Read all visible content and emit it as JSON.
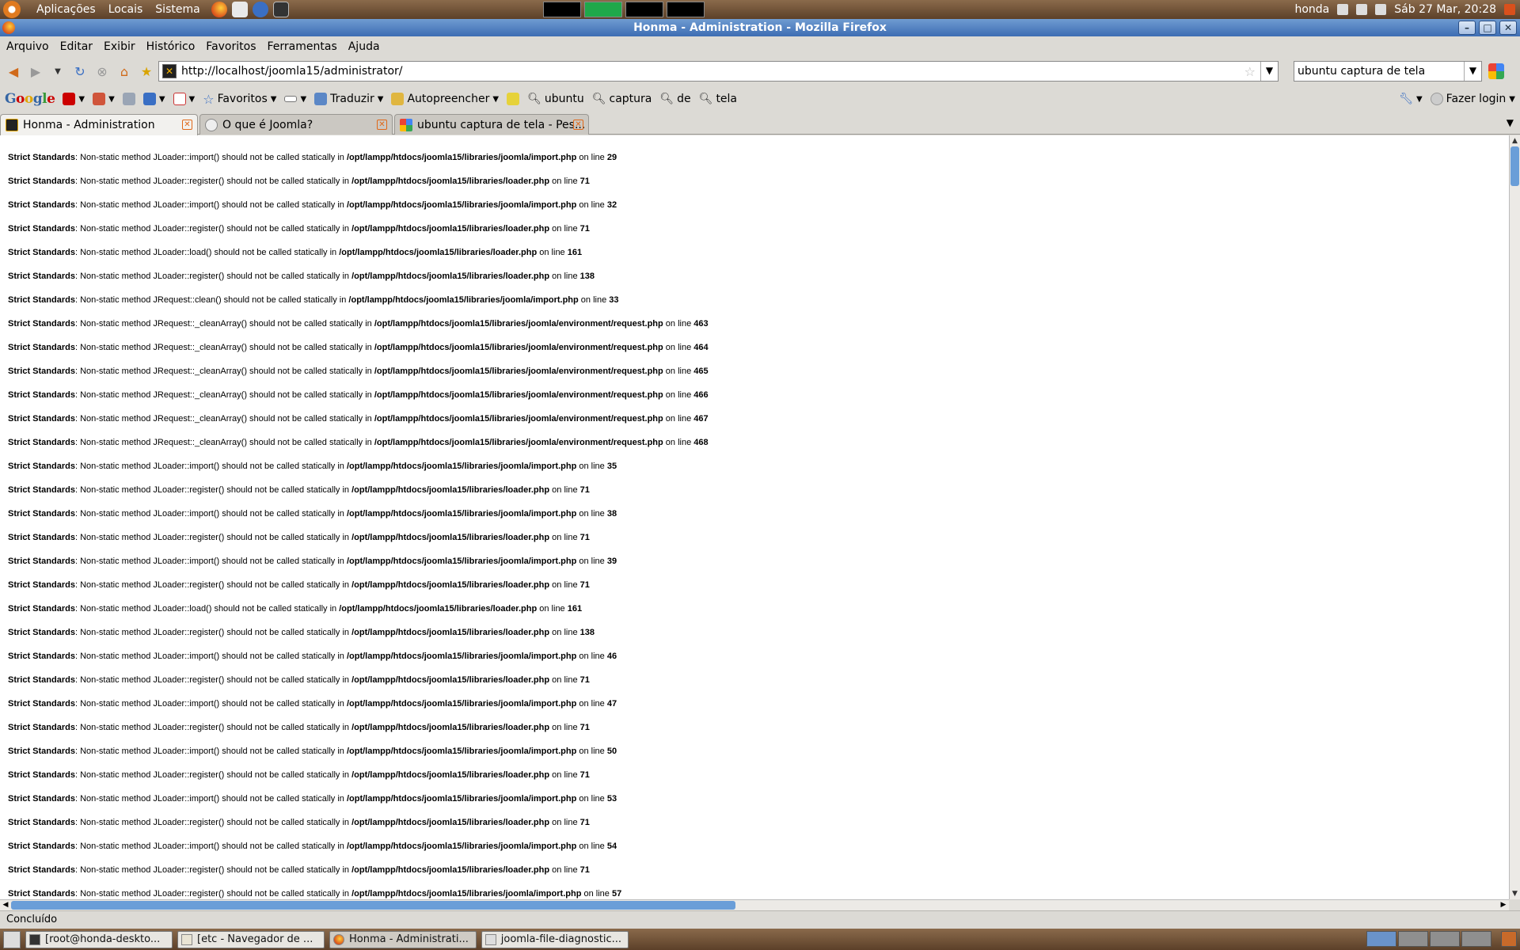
{
  "top_panel": {
    "menus": [
      "Aplicações",
      "Locais",
      "Sistema"
    ],
    "user": "honda",
    "clock": "Sáb 27 Mar, 20:28"
  },
  "window": {
    "title": "Honma - Administration - Mozilla Firefox"
  },
  "menubar": [
    "Arquivo",
    "Editar",
    "Exibir",
    "Histórico",
    "Favoritos",
    "Ferramentas",
    "Ajuda"
  ],
  "navigation": {
    "url": "http://localhost/joomla15/administrator/",
    "search_value": "ubuntu captura de tela"
  },
  "google_toolbar": {
    "logo": "Google",
    "items": [
      "Favoritos",
      "Traduzir",
      "Autopreencher",
      "ubuntu",
      "captura",
      "de",
      "tela"
    ],
    "login": "Fazer login"
  },
  "tabs": [
    {
      "label": "Honma - Administration",
      "active": true
    },
    {
      "label": "O que é Joomla?",
      "active": false
    },
    {
      "label": "ubuntu captura de tela - Pes...",
      "active": false
    }
  ],
  "messages": [
    {
      "label": "Strict Standards",
      "text": ": Non-static method JLoader::import() should not be called statically in ",
      "path": "/opt/lampp/htdocs/joomla15/libraries/joomla/import.php",
      "on": " on line ",
      "line": "29"
    },
    {
      "label": "Strict Standards",
      "text": ": Non-static method JLoader::register() should not be called statically in ",
      "path": "/opt/lampp/htdocs/joomla15/libraries/loader.php",
      "on": " on line ",
      "line": "71"
    },
    {
      "label": "Strict Standards",
      "text": ": Non-static method JLoader::import() should not be called statically in ",
      "path": "/opt/lampp/htdocs/joomla15/libraries/joomla/import.php",
      "on": " on line ",
      "line": "32"
    },
    {
      "label": "Strict Standards",
      "text": ": Non-static method JLoader::register() should not be called statically in ",
      "path": "/opt/lampp/htdocs/joomla15/libraries/loader.php",
      "on": " on line ",
      "line": "71"
    },
    {
      "label": "Strict Standards",
      "text": ": Non-static method JLoader::load() should not be called statically in ",
      "path": "/opt/lampp/htdocs/joomla15/libraries/loader.php",
      "on": " on line ",
      "line": "161"
    },
    {
      "label": "Strict Standards",
      "text": ": Non-static method JLoader::register() should not be called statically in ",
      "path": "/opt/lampp/htdocs/joomla15/libraries/loader.php",
      "on": " on line ",
      "line": "138"
    },
    {
      "label": "Strict Standards",
      "text": ": Non-static method JRequest::clean() should not be called statically in ",
      "path": "/opt/lampp/htdocs/joomla15/libraries/joomla/import.php",
      "on": " on line ",
      "line": "33"
    },
    {
      "label": "Strict Standards",
      "text": ": Non-static method JRequest::_cleanArray() should not be called statically in ",
      "path": "/opt/lampp/htdocs/joomla15/libraries/joomla/environment/request.php",
      "on": " on line ",
      "line": "463"
    },
    {
      "label": "Strict Standards",
      "text": ": Non-static method JRequest::_cleanArray() should not be called statically in ",
      "path": "/opt/lampp/htdocs/joomla15/libraries/joomla/environment/request.php",
      "on": " on line ",
      "line": "464"
    },
    {
      "label": "Strict Standards",
      "text": ": Non-static method JRequest::_cleanArray() should not be called statically in ",
      "path": "/opt/lampp/htdocs/joomla15/libraries/joomla/environment/request.php",
      "on": " on line ",
      "line": "465"
    },
    {
      "label": "Strict Standards",
      "text": ": Non-static method JRequest::_cleanArray() should not be called statically in ",
      "path": "/opt/lampp/htdocs/joomla15/libraries/joomla/environment/request.php",
      "on": " on line ",
      "line": "466"
    },
    {
      "label": "Strict Standards",
      "text": ": Non-static method JRequest::_cleanArray() should not be called statically in ",
      "path": "/opt/lampp/htdocs/joomla15/libraries/joomla/environment/request.php",
      "on": " on line ",
      "line": "467"
    },
    {
      "label": "Strict Standards",
      "text": ": Non-static method JRequest::_cleanArray() should not be called statically in ",
      "path": "/opt/lampp/htdocs/joomla15/libraries/joomla/environment/request.php",
      "on": " on line ",
      "line": "468"
    },
    {
      "label": "Strict Standards",
      "text": ": Non-static method JLoader::import() should not be called statically in ",
      "path": "/opt/lampp/htdocs/joomla15/libraries/joomla/import.php",
      "on": " on line ",
      "line": "35"
    },
    {
      "label": "Strict Standards",
      "text": ": Non-static method JLoader::register() should not be called statically in ",
      "path": "/opt/lampp/htdocs/joomla15/libraries/loader.php",
      "on": " on line ",
      "line": "71"
    },
    {
      "label": "Strict Standards",
      "text": ": Non-static method JLoader::import() should not be called statically in ",
      "path": "/opt/lampp/htdocs/joomla15/libraries/joomla/import.php",
      "on": " on line ",
      "line": "38"
    },
    {
      "label": "Strict Standards",
      "text": ": Non-static method JLoader::register() should not be called statically in ",
      "path": "/opt/lampp/htdocs/joomla15/libraries/loader.php",
      "on": " on line ",
      "line": "71"
    },
    {
      "label": "Strict Standards",
      "text": ": Non-static method JLoader::import() should not be called statically in ",
      "path": "/opt/lampp/htdocs/joomla15/libraries/joomla/import.php",
      "on": " on line ",
      "line": "39"
    },
    {
      "label": "Strict Standards",
      "text": ": Non-static method JLoader::register() should not be called statically in ",
      "path": "/opt/lampp/htdocs/joomla15/libraries/loader.php",
      "on": " on line ",
      "line": "71"
    },
    {
      "label": "Strict Standards",
      "text": ": Non-static method JLoader::load() should not be called statically in ",
      "path": "/opt/lampp/htdocs/joomla15/libraries/loader.php",
      "on": " on line ",
      "line": "161"
    },
    {
      "label": "Strict Standards",
      "text": ": Non-static method JLoader::register() should not be called statically in ",
      "path": "/opt/lampp/htdocs/joomla15/libraries/loader.php",
      "on": " on line ",
      "line": "138"
    },
    {
      "label": "Strict Standards",
      "text": ": Non-static method JLoader::import() should not be called statically in ",
      "path": "/opt/lampp/htdocs/joomla15/libraries/joomla/import.php",
      "on": " on line ",
      "line": "46"
    },
    {
      "label": "Strict Standards",
      "text": ": Non-static method JLoader::register() should not be called statically in ",
      "path": "/opt/lampp/htdocs/joomla15/libraries/loader.php",
      "on": " on line ",
      "line": "71"
    },
    {
      "label": "Strict Standards",
      "text": ": Non-static method JLoader::import() should not be called statically in ",
      "path": "/opt/lampp/htdocs/joomla15/libraries/joomla/import.php",
      "on": " on line ",
      "line": "47"
    },
    {
      "label": "Strict Standards",
      "text": ": Non-static method JLoader::register() should not be called statically in ",
      "path": "/opt/lampp/htdocs/joomla15/libraries/loader.php",
      "on": " on line ",
      "line": "71"
    },
    {
      "label": "Strict Standards",
      "text": ": Non-static method JLoader::import() should not be called statically in ",
      "path": "/opt/lampp/htdocs/joomla15/libraries/joomla/import.php",
      "on": " on line ",
      "line": "50"
    },
    {
      "label": "Strict Standards",
      "text": ": Non-static method JLoader::register() should not be called statically in ",
      "path": "/opt/lampp/htdocs/joomla15/libraries/loader.php",
      "on": " on line ",
      "line": "71"
    },
    {
      "label": "Strict Standards",
      "text": ": Non-static method JLoader::import() should not be called statically in ",
      "path": "/opt/lampp/htdocs/joomla15/libraries/joomla/import.php",
      "on": " on line ",
      "line": "53"
    },
    {
      "label": "Strict Standards",
      "text": ": Non-static method JLoader::register() should not be called statically in ",
      "path": "/opt/lampp/htdocs/joomla15/libraries/loader.php",
      "on": " on line ",
      "line": "71"
    },
    {
      "label": "Strict Standards",
      "text": ": Non-static method JLoader::import() should not be called statically in ",
      "path": "/opt/lampp/htdocs/joomla15/libraries/joomla/import.php",
      "on": " on line ",
      "line": "54"
    },
    {
      "label": "Strict Standards",
      "text": ": Non-static method JLoader::register() should not be called statically in ",
      "path": "/opt/lampp/htdocs/joomla15/libraries/loader.php",
      "on": " on line ",
      "line": "71"
    },
    {
      "label": "Strict Standards",
      "text": ": Non-static method JLoader::register() should not be called statically in ",
      "path": "/opt/lampp/htdocs/joomla15/libraries/joomla/import.php",
      "on": " on line ",
      "line": "57"
    }
  ],
  "status_text": "Concluído",
  "taskbar": [
    {
      "label": "[root@honda-deskto...",
      "active": false
    },
    {
      "label": "[etc - Navegador de ...",
      "active": false
    },
    {
      "label": "Honma - Administrati...",
      "active": true
    },
    {
      "label": "joomla-file-diagnostic...",
      "active": false
    }
  ],
  "colors": {
    "panel": "#6e4f35",
    "titlebar": "#4f7fc0",
    "accent": "#6a9ed8",
    "close_tab": "#e06818"
  }
}
